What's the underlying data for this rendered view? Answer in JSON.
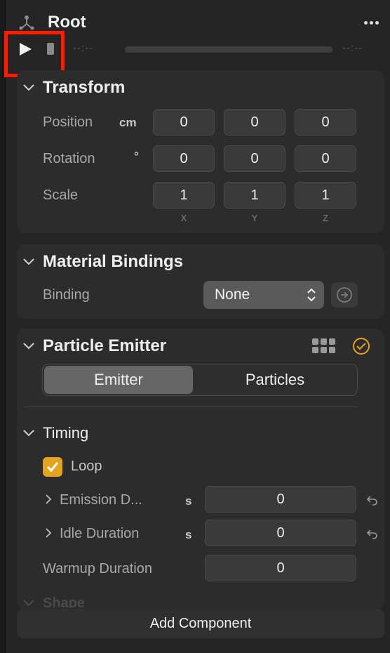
{
  "header": {
    "title": "Root",
    "icon": "hierarchy-icon",
    "menu_icon": "more-icon"
  },
  "playback": {
    "time_start": "--:--",
    "time_end": "--:--",
    "progress": 0
  },
  "transform": {
    "title": "Transform",
    "rows": [
      {
        "label": "Position",
        "unit": "cm",
        "x": "0",
        "y": "0",
        "z": "0"
      },
      {
        "label": "Rotation",
        "unit": "°",
        "x": "0",
        "y": "0",
        "z": "0"
      },
      {
        "label": "Scale",
        "unit": "",
        "x": "1",
        "y": "1",
        "z": "1"
      }
    ],
    "axes": [
      "X",
      "Y",
      "Z"
    ]
  },
  "material_bindings": {
    "title": "Material Bindings",
    "binding_label": "Binding",
    "binding_value": "None"
  },
  "particle_emitter": {
    "title": "Particle Emitter",
    "enabled": true,
    "tabs": [
      {
        "label": "Emitter",
        "active": true
      },
      {
        "label": "Particles",
        "active": false
      }
    ],
    "timing": {
      "title": "Timing",
      "loop_label": "Loop",
      "loop_checked": true,
      "rows": [
        {
          "label": "Emission D...",
          "unit": "s",
          "value": "0"
        },
        {
          "label": "Idle Duration",
          "unit": "s",
          "value": "0"
        },
        {
          "label": "Warmup Duration",
          "unit": "",
          "value": "0"
        }
      ]
    },
    "next_section": "Shape"
  },
  "footer": {
    "add_component_label": "Add Component"
  },
  "colors": {
    "accent": "#e6a41e",
    "highlight": "#ff1a00",
    "panel": "#2c2c2c",
    "background": "#252525"
  }
}
